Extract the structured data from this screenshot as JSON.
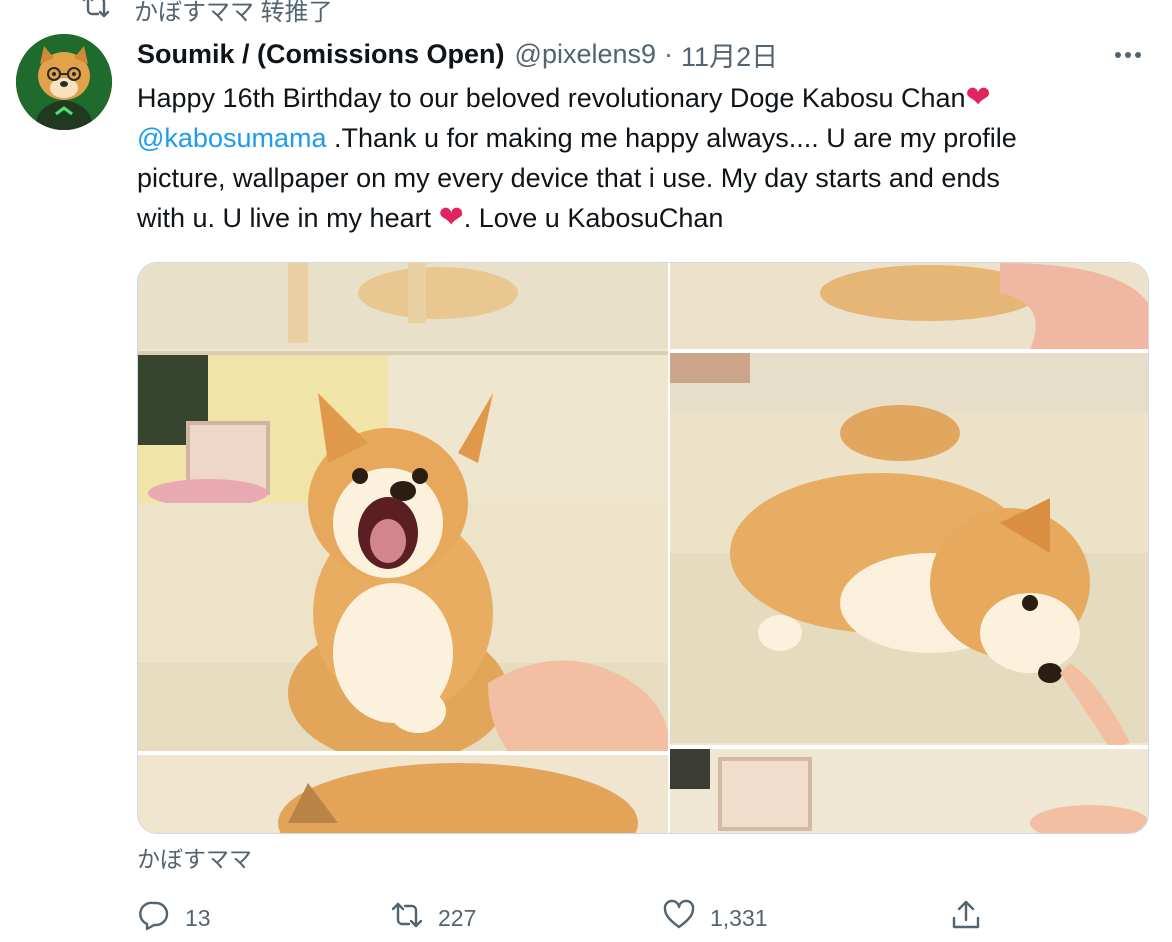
{
  "retweet_context": {
    "icon": "retweet-icon",
    "text": "かぼすママ 转推了"
  },
  "tweet": {
    "author_name": "Soumik / (Comissions Open)",
    "author_handle": "@pixelens9",
    "separator": "·",
    "timestamp": "11月2日",
    "text": {
      "line1": "Happy 16th Birthday to our beloved revolutionary  Doge Kabosu Chan",
      "mention": "@kabosumama",
      "line2_rest": " .Thank u for making me happy always.... U are my profile",
      "line3": "picture, wallpaper on my every device that i use. My day starts and ends",
      "line4_start": "with u. U live in my heart ",
      "line4_end": ". Love u KabosuChan",
      "heart_emoji": "❤"
    },
    "media_source": "かぼすママ"
  },
  "actions": {
    "reply_count": "13",
    "retweet_count": "227",
    "like_count": "1,331"
  },
  "colors": {
    "link": "#1d9bf0",
    "secondary_text": "#536471",
    "heart": "#e0245e",
    "primary_text": "#0f1419"
  }
}
